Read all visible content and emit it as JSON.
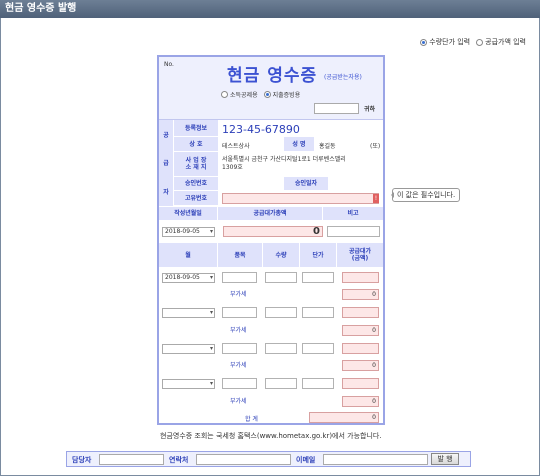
{
  "window": {
    "title": "현금 영수증 발행"
  },
  "mode": {
    "unit_price": "수량단가 입력",
    "supply_price": "공급가액 입력"
  },
  "receipt": {
    "no_label": "No.",
    "title": "현금 영수증",
    "subtitle": "(공급받는자용)",
    "purpose": {
      "income": "소득공제용",
      "expense": "지출증빙용"
    },
    "guest_suffix": "귀하",
    "supplier_label": [
      "공",
      "급",
      "자"
    ],
    "reg_label": "등록정보",
    "reg_number": "123-45-67890",
    "company_label": "상 호",
    "company_value": "테스트상사",
    "name_label": "성 명",
    "name_value": "홍길동",
    "name_seal": "(또)",
    "address_label": "사 업 장\n소 재 지",
    "address_value": "서울특별시 금천구 가산디지털1로1 더루벤스밸리\n1309호",
    "approval_label": "승인번호",
    "approval_date_label": "승인일자",
    "unique_label": "고유번호",
    "date_label": "작성년월일",
    "total_label": "공급대가총액",
    "remark_label": "비고",
    "date_value": "2018-09-05",
    "total_value": "0",
    "col_month": "월",
    "col_item": "품목",
    "col_qty": "수량",
    "col_price": "단가",
    "col_amount": "공급대가\n(금액)",
    "rows": [
      {
        "date": "2018-09-05",
        "vat": "부가세",
        "zero": "0"
      },
      {
        "date": "",
        "vat": "부가세",
        "zero": "0"
      },
      {
        "date": "",
        "vat": "부가세",
        "zero": "0"
      },
      {
        "date": "",
        "vat": "부가세",
        "zero": "0"
      }
    ],
    "sum_label": "합 계",
    "sum_value": "0"
  },
  "tooltip": "이 값은 필수입니다.",
  "note": "현금영수증 조회는 국세청 홈택스(www.hometax.go.kr)에서 가능합니다.",
  "footer": {
    "manager": "담당자",
    "contact": "연락처",
    "email": "이메일",
    "issue_button": "발 행"
  }
}
